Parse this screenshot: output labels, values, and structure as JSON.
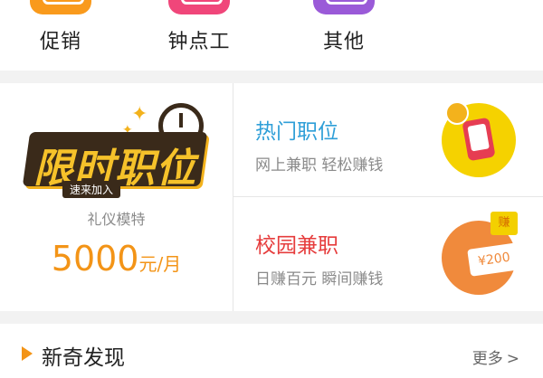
{
  "categories": [
    {
      "label": "促销",
      "color": "#f99a1c",
      "icon": "promo-icon"
    },
    {
      "label": "钟点工",
      "color": "#f0467a",
      "icon": "hourly-worker-icon"
    },
    {
      "label": "其他",
      "color": "#9a5ad8",
      "icon": "other-icon"
    }
  ],
  "promo": {
    "badge": {
      "text": "限时职位",
      "sub": "速来加入"
    },
    "job_title": "礼仪模特",
    "salary": {
      "amount": "5000",
      "unit": "元/月"
    },
    "cards": [
      {
        "title": "热门职位",
        "subtitle": "网上兼职  轻松赚钱",
        "color": "#2f9fd8",
        "icon": "phone-coin-icon"
      },
      {
        "title": "校园兼职",
        "subtitle": "日赚百元  瞬间赚钱",
        "color": "#e63d3d",
        "icon": "money-ticket-icon",
        "ticket_text": "¥200",
        "tag": "赚"
      }
    ]
  },
  "discover": {
    "title": "新奇发现",
    "more": "更多",
    "more_chevron": ">"
  }
}
